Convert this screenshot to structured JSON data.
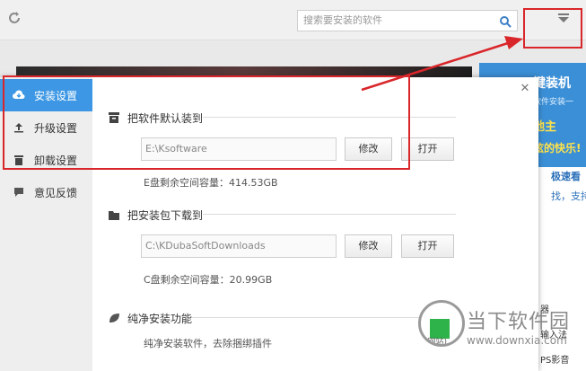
{
  "app": {
    "search_placeholder": "搜索要安装的软件",
    "ad": {
      "title": "键装机",
      "sub": "软件安装一",
      "yellow": "地主",
      "yellow2": "炫的快乐!"
    },
    "recommend": {
      "title": "极速看",
      "sub": "找，支持"
    },
    "right_list": [
      "器",
      "输入法",
      "PS影音"
    ]
  },
  "dialog": {
    "nav": [
      {
        "label": "安装设置",
        "icon": "cloud-download-icon"
      },
      {
        "label": "升级设置",
        "icon": "upload-icon"
      },
      {
        "label": "卸载设置",
        "icon": "trash-icon"
      },
      {
        "label": "意见反馈",
        "icon": "chat-bubble-icon"
      }
    ],
    "install_dir": {
      "title": "把软件默认装到",
      "path": "E:\\Ksoftware",
      "modify_label": "修改",
      "open_label": "打开",
      "free_space": "E盘剩余空间容量：414.53GB"
    },
    "download_dir": {
      "title": "把安装包下载到",
      "path": "C:\\KDubaSoftDownloads",
      "modify_label": "修改",
      "open_label": "打开",
      "free_space": "C盘剩余空间容量：20.99GB"
    },
    "clean_install": {
      "title": "纯净安装功能",
      "desc": "纯净安装软件，去除捆绑插件"
    }
  },
  "watermark": {
    "text": "当下软件园",
    "url": "www.downxia.com",
    "badge": "(网站)"
  },
  "colors": {
    "accent": "#3d97e4",
    "annotation": "#d9262a"
  }
}
